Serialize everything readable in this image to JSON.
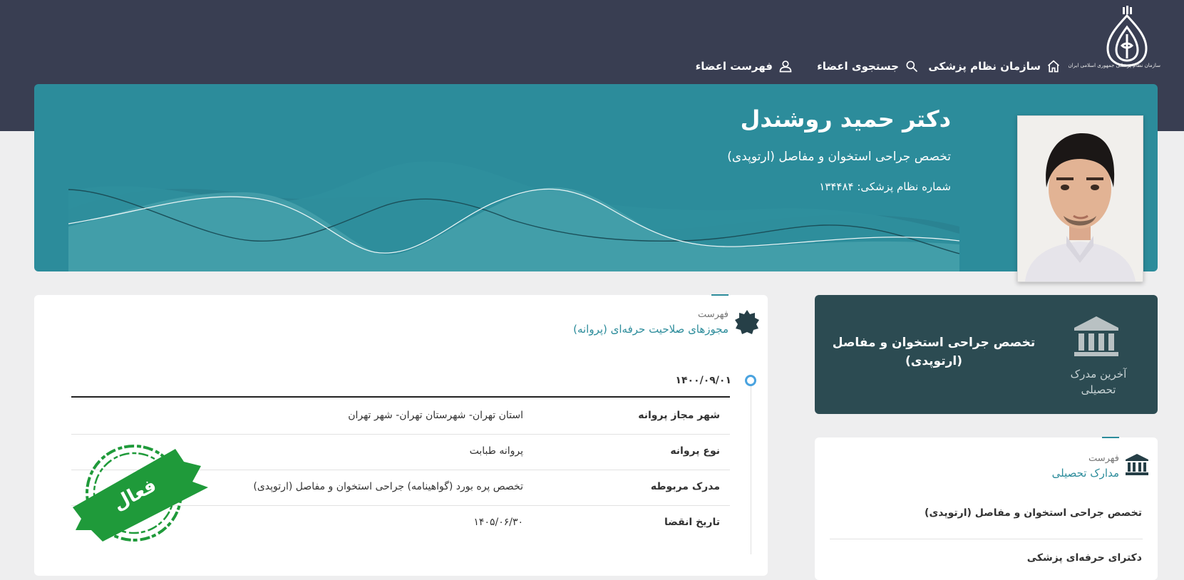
{
  "logo": {
    "caption": "سازمان نظام پزشکی جمهوری اسلامی ایران"
  },
  "nav": {
    "home_label": "سازمان نظام پزشکی",
    "search_label": "جستجوی اعضاء",
    "members_label": "فهرست اعضاء"
  },
  "hero": {
    "name": "دکتر حمید روشندل",
    "specialty": "تخصص جراحی استخوان و مفاصل (ارتوپدی)",
    "number_label": "شماره نظام پزشکی:",
    "number_value": "۱۳۴۴۸۴"
  },
  "latest_degree": {
    "label_line1": "آخرین مدرک",
    "label_line2": "تحصیلی",
    "value_line1": "تخصص جراحی استخوان و مفاصل",
    "value_line2": "(ارتوپدی)"
  },
  "licenses": {
    "small_label": "فهرست",
    "title": "مجوزهای صلاحیت حرفه‌ای (پروانه)",
    "date": "۱۴۰۰/۰۹/۰۱",
    "rows": [
      {
        "label": "شهر مجاز پروانه",
        "value": "استان تهران- شهرستان تهران- شهر تهران"
      },
      {
        "label": "نوع پروانه",
        "value": "پروانه طبابت"
      },
      {
        "label": "مدرک مربوطه",
        "value": "تخصص پره بورد (گواهینامه) جراحی استخوان و مفاصل (ارتوپدی)"
      },
      {
        "label": "تاریخ انقضا",
        "value": "۱۴۰۵/۰۶/۳۰"
      }
    ],
    "stamp_text": "فعال"
  },
  "education": {
    "small_label": "فهرست",
    "title": "مدارک تحصیلی",
    "items": [
      "تخصص جراحی استخوان و مفاصل (ارتوپدی)",
      "دکترای حرفه‌ای پزشکی"
    ]
  },
  "colors": {
    "header_bg": "#393e52",
    "hero_bg": "#2c8c9b",
    "dark_card_bg": "#2c4b52",
    "accent": "#2c8c9b",
    "stamp_green": "#1f9a3a"
  }
}
